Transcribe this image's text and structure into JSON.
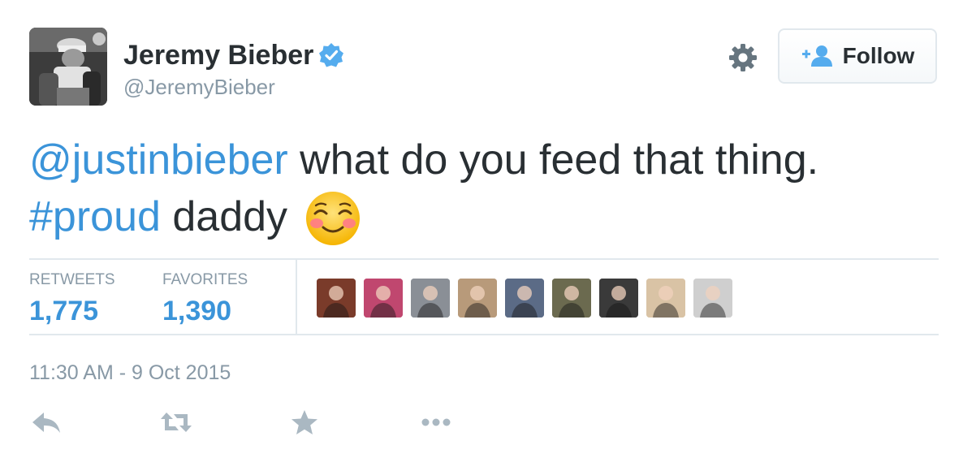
{
  "tweet": {
    "author_name": "Jeremy Bieber",
    "author_handle": "@JeremyBieber",
    "text_mention": "@justinbieber",
    "text_main": " what do you feed that thing.",
    "text_hashtag": "#proud",
    "text_end": " daddy",
    "emoji": "smiling-face-with-blush-emoji",
    "timestamp": "11:30 AM - 9 Oct 2015"
  },
  "follow_button": {
    "label": "Follow"
  },
  "stats": {
    "retweets_label": "RETWEETS",
    "retweets_value": "1,775",
    "favorites_label": "FAVORITES",
    "favorites_value": "1,390"
  },
  "favoriter_avatars": [
    {
      "name": "favoriter-avatar-1",
      "bg": "#7a3b2a"
    },
    {
      "name": "favoriter-avatar-2",
      "bg": "#c0476f"
    },
    {
      "name": "favoriter-avatar-3",
      "bg": "#8a8f96"
    },
    {
      "name": "favoriter-avatar-4",
      "bg": "#b89a7a"
    },
    {
      "name": "favoriter-avatar-5",
      "bg": "#5b6b86"
    },
    {
      "name": "favoriter-avatar-6",
      "bg": "#6b6a4f"
    },
    {
      "name": "favoriter-avatar-7",
      "bg": "#3a3a3a"
    },
    {
      "name": "favoriter-avatar-8",
      "bg": "#d9c3a5"
    },
    {
      "name": "favoriter-avatar-9",
      "bg": "#cfcfcf"
    }
  ],
  "colors": {
    "link": "#3b94d9",
    "muted": "#8899a6",
    "text": "#292f33",
    "verified": "#55acee"
  },
  "icons": {
    "verified": "verified-badge-icon",
    "gear": "gear-icon",
    "follow": "add-user-icon",
    "reply": "reply-icon",
    "retweet": "retweet-icon",
    "favorite": "star-icon",
    "more": "more-dots-icon"
  }
}
